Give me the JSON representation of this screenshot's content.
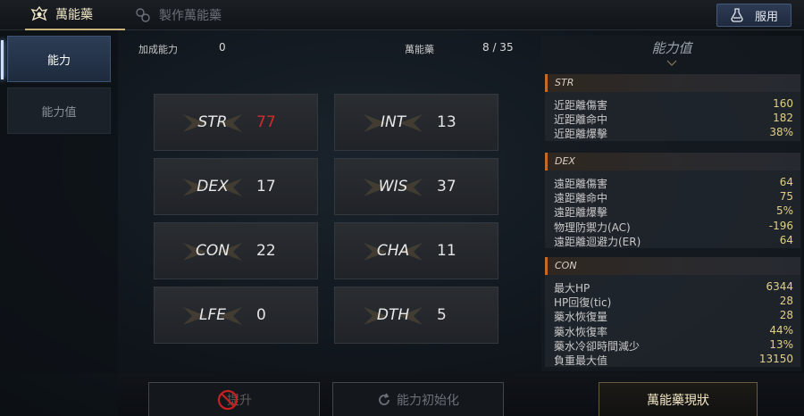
{
  "tabs": [
    {
      "label": "萬能藥",
      "icon": "potion-emblem-icon"
    },
    {
      "label": "製作萬能藥",
      "icon": "craft-potion-icon"
    }
  ],
  "use_button": {
    "label": "服用",
    "icon": "potion-flask-icon"
  },
  "nav": [
    {
      "label": "能力"
    },
    {
      "label": "能力值"
    }
  ],
  "header": {
    "bonus_label": "加成能力",
    "bonus_value": "0",
    "potion_label": "萬能藥",
    "potion_value": "8 / 35"
  },
  "stats": [
    {
      "name": "STR",
      "value": "77",
      "highlight": "#d42b2b"
    },
    {
      "name": "INT",
      "value": "13"
    },
    {
      "name": "DEX",
      "value": "17"
    },
    {
      "name": "WIS",
      "value": "37"
    },
    {
      "name": "CON",
      "value": "22"
    },
    {
      "name": "CHA",
      "value": "11"
    },
    {
      "name": "LFE",
      "value": "0"
    },
    {
      "name": "DTH",
      "value": "5"
    }
  ],
  "panel": {
    "title": "能力值",
    "sections": [
      {
        "name": "STR",
        "rows": [
          {
            "k": "近距離傷害",
            "v": "160"
          },
          {
            "k": "近距離命中",
            "v": "182"
          },
          {
            "k": "近距離爆擊",
            "v": "38%"
          }
        ]
      },
      {
        "name": "DEX",
        "rows": [
          {
            "k": "遠距離傷害",
            "v": "64"
          },
          {
            "k": "遠距離命中",
            "v": "75"
          },
          {
            "k": "遠距離爆擊",
            "v": "5%"
          },
          {
            "k": "物理防禦力(AC)",
            "v": "-196"
          },
          {
            "k": "遠距離迴避力(ER)",
            "v": "64"
          }
        ]
      },
      {
        "name": "CON",
        "rows": [
          {
            "k": "最大HP",
            "v": "6344"
          },
          {
            "k": "HP回復(tic)",
            "v": "28"
          },
          {
            "k": "藥水恢復量",
            "v": "28"
          },
          {
            "k": "藥水恢復率",
            "v": "44%"
          },
          {
            "k": "藥水冷卻時間減少",
            "v": "13%"
          },
          {
            "k": "負重最大值",
            "v": "13150"
          }
        ]
      }
    ]
  },
  "bottom": {
    "disabled_label": "提升",
    "reset_label": "能力初始化",
    "status_label": "萬能藥現狀"
  },
  "colors": {
    "accent_gold": "#e3cf8a",
    "section_marker": "#c26a28",
    "highlight_red": "#d42b2b"
  }
}
